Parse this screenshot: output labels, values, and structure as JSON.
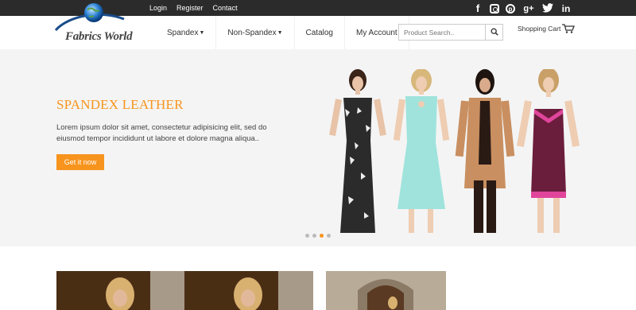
{
  "topbar": {
    "links": [
      "Login",
      "Register",
      "Contact"
    ],
    "social_icons": [
      "facebook-icon",
      "instagram-icon",
      "pinterest-icon",
      "google-plus-icon",
      "twitter-icon",
      "linkedin-icon"
    ],
    "social_glyphs": {
      "facebook": "f",
      "pinterest": "p",
      "google_plus": "g+",
      "twitter": "t",
      "linkedin": "in"
    }
  },
  "header": {
    "logo_text": "Fabrics World",
    "nav": [
      "Spandex",
      "Non-Spandex",
      "Catalog",
      "My Account"
    ],
    "search_placeholder": "Product Search..",
    "cart_label": "Shopping Cart"
  },
  "hero": {
    "title": "SPANDEX LEATHER",
    "text": "Lorem ipsum dolor sit amet, consectetur adipisicing elit, sed do eiusmod tempor incididunt ut labore et dolore magna aliqua..",
    "button_label": "Get it now",
    "slide_count": 4,
    "active_slide": 3
  },
  "colors": {
    "accent": "#f7941d",
    "topbar": "#2b2b2b"
  }
}
